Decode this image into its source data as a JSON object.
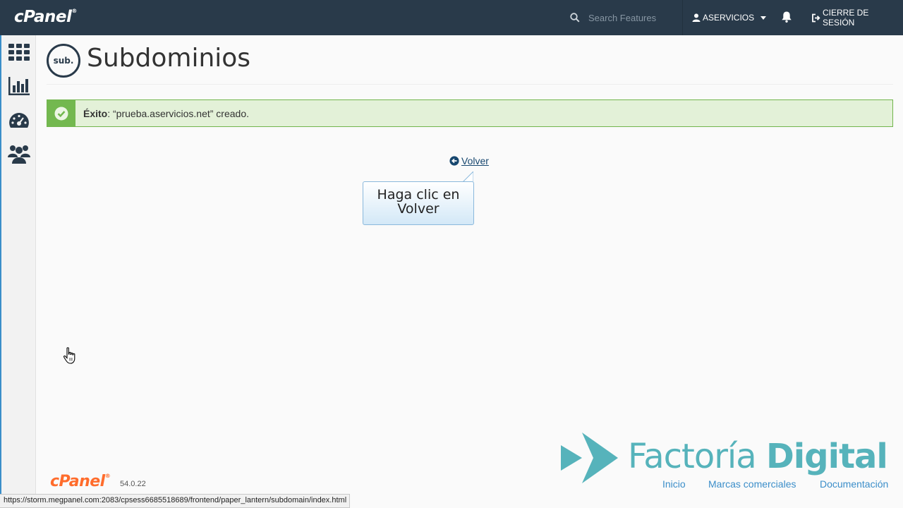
{
  "topbar": {
    "logo": "cPanel",
    "search": {
      "placeholder": "Search Features",
      "value": ""
    },
    "user": "ASERVICIOS",
    "logout": "CIERRE DE SESIÓN"
  },
  "sidebar": {
    "items": [
      {
        "icon": "grid-icon"
      },
      {
        "icon": "bar-chart-icon"
      },
      {
        "icon": "dashboard-gauge-icon"
      },
      {
        "icon": "users-icon"
      }
    ]
  },
  "page": {
    "icon_text": "sub.",
    "title": "Subdominios"
  },
  "alert": {
    "label": "Éxito",
    "message": ": “prueba.aservicios.net” creado."
  },
  "back_link": "Volver",
  "callout": "Haga clic en Volver",
  "footer": {
    "logo": "cPanel",
    "version": "54.0.22",
    "links": [
      "Inicio",
      "Marcas comerciales",
      "Documentación"
    ]
  },
  "watermark": {
    "word1": "Factoría",
    "word2": "Digital"
  },
  "statusbar": "https://storm.megpanel.com:2083/cpsess6685518689/frontend/paper_lantern/subdomain/index.html",
  "colors": {
    "topbar": "#293a4a",
    "success_bg": "#e3f1d8",
    "success_accent": "#73b84f",
    "link": "#3b8ec9",
    "brand_orange": "#ff6c2c",
    "watermark": "#56b3bb"
  }
}
